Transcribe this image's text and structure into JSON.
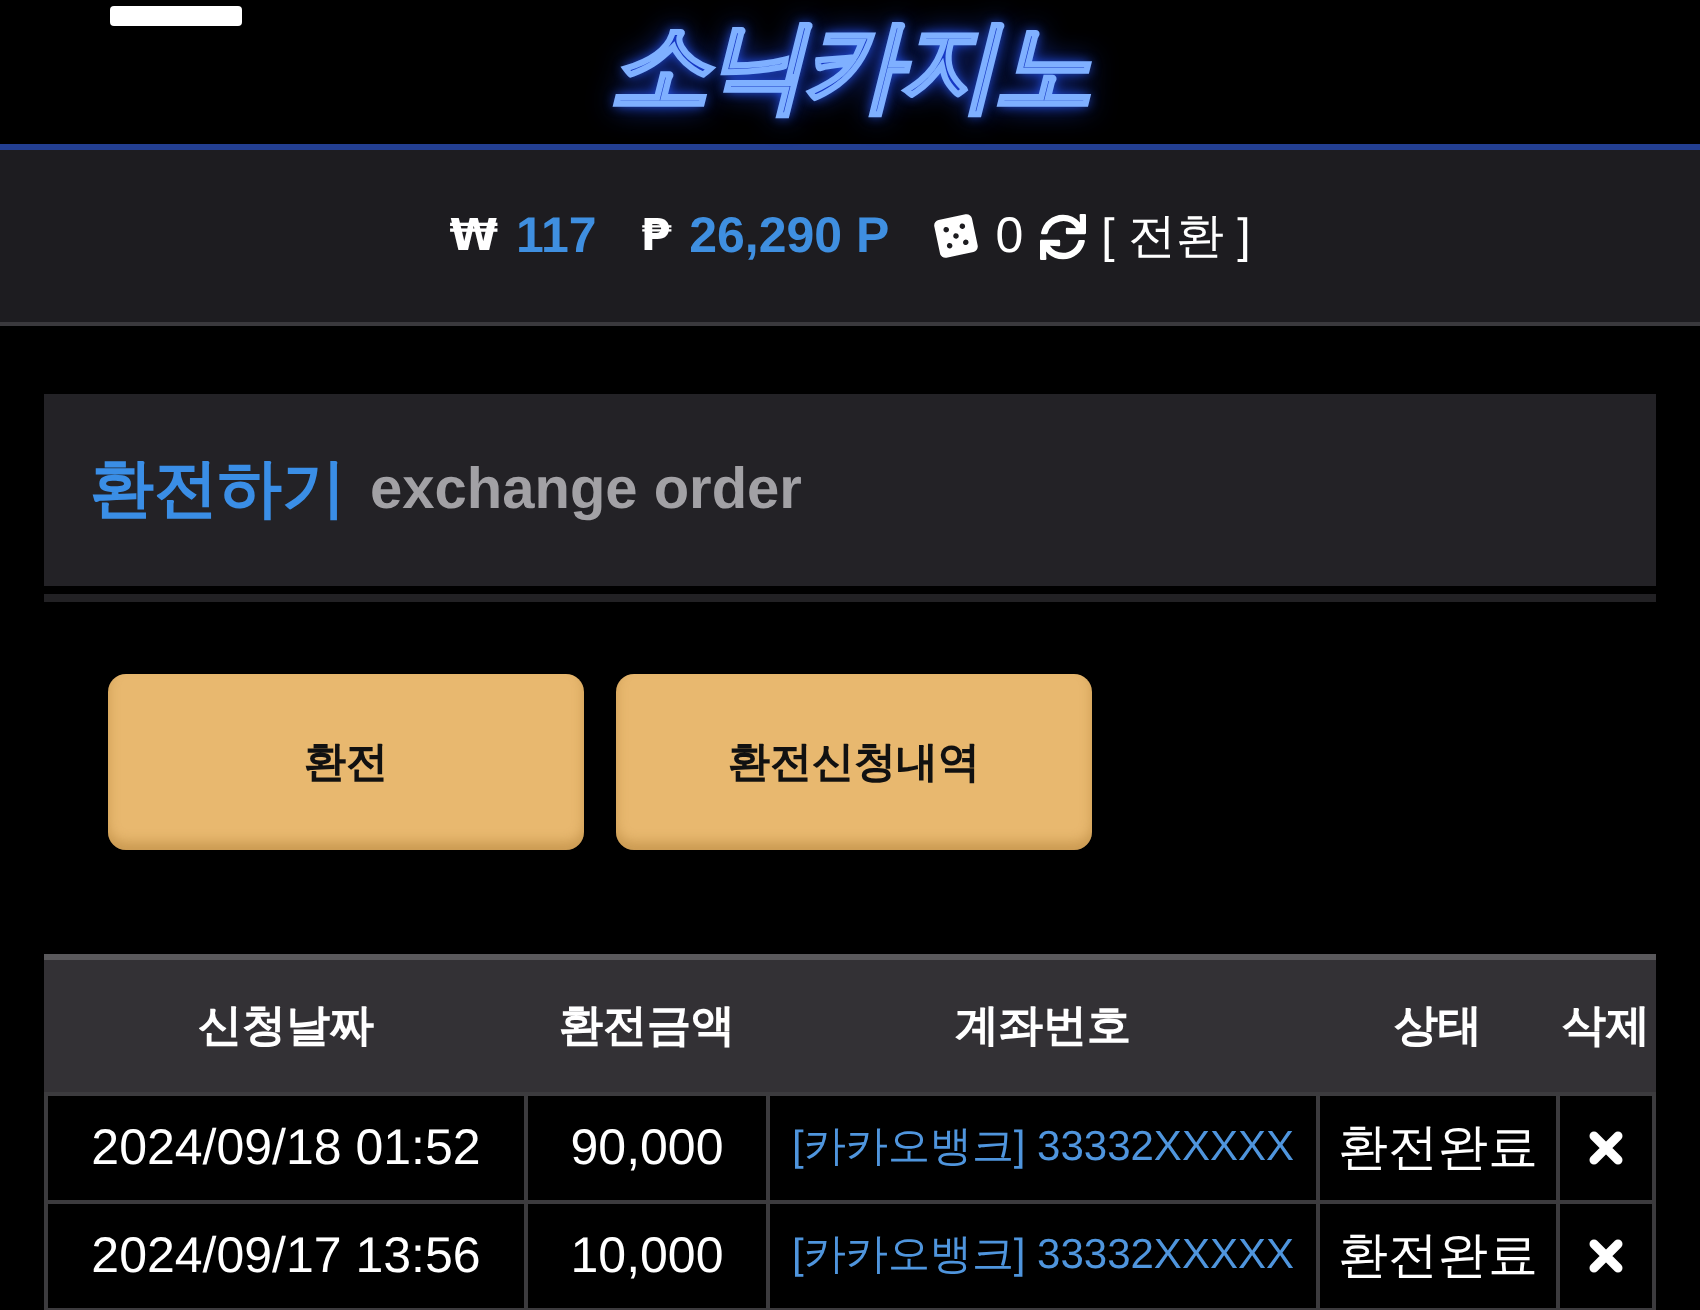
{
  "header": {
    "logo": "소닉카지노"
  },
  "balance_bar": {
    "items": [
      {
        "kind": "currency",
        "symbol": "₩",
        "value": "117"
      },
      {
        "kind": "currency",
        "symbol": "₱",
        "value": "26,290 P"
      },
      {
        "kind": "chips",
        "value": "0"
      },
      {
        "kind": "convert",
        "label": "[ 전환 ]"
      }
    ]
  },
  "panel": {
    "title": "환전하기",
    "subtitle": "exchange order"
  },
  "buttons": [
    {
      "label": "환전"
    },
    {
      "label": "환전신청내역"
    }
  ],
  "table": {
    "columns": [
      "신청날짜",
      "환전금액",
      "계좌번호",
      "상태",
      "삭제"
    ],
    "rows": [
      {
        "date": "2024/09/18 01:52",
        "amount": "90,000",
        "account": "[카카오뱅크] 33332XXXXX",
        "status": "환전완료"
      },
      {
        "date": "2024/09/17 13:56",
        "amount": "10,000",
        "account": "[카카오뱅크] 33332XXXXX",
        "status": "환전완료"
      }
    ]
  }
}
